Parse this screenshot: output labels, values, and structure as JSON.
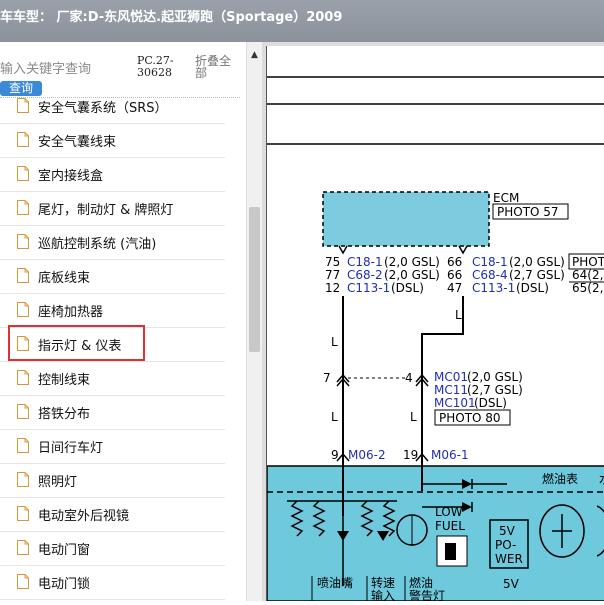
{
  "window": {
    "title": "车车型：  厂家:D-东风悦达.起亚狮跑（Sportage）2009"
  },
  "sidebar": {
    "search_placeholder": "输入关键字查询",
    "query_button": "查询",
    "pc_code_1": "PC.27-",
    "pc_code_2": "30628",
    "collapse_all_1": "折叠全",
    "collapse_all_2": "部",
    "items": [
      {
        "label": "安全气囊系统（SRS）"
      },
      {
        "label": "安全气囊线束"
      },
      {
        "label": "室内接线盒"
      },
      {
        "label": "尾灯，制动灯 & 牌照灯"
      },
      {
        "label": "巡航控制系统 (汽油)"
      },
      {
        "label": "底板线束"
      },
      {
        "label": "座椅加热器"
      },
      {
        "label": "指示灯 & 仪表"
      },
      {
        "label": "控制线束"
      },
      {
        "label": "搭铁分布"
      },
      {
        "label": "日间行车灯"
      },
      {
        "label": "照明灯"
      },
      {
        "label": "电动室外后视镜"
      },
      {
        "label": "电动门窗"
      },
      {
        "label": "电动门锁"
      }
    ],
    "selected_index": 7
  },
  "diagram": {
    "ecm_label": "ECM",
    "photo57": "PHOTO 57",
    "photo_cut": "PHOT",
    "left_pins": [
      "75",
      "77",
      "12"
    ],
    "left_conns": [
      "C18-1",
      "C68-2",
      "C113-1"
    ],
    "left_specs": [
      "(2,0 GSL)",
      "(2,0 GSL)",
      "(DSL)"
    ],
    "right_pins": [
      "66",
      "66",
      "47"
    ],
    "right_conns": [
      "C18-1",
      "C68-4",
      "C113-1"
    ],
    "right_specs": [
      "(2,0 GSL)",
      "(2,7 GSL)",
      "(DSL)"
    ],
    "far_right": [
      "64(2,0",
      "65(2,7"
    ],
    "wire_l": "L",
    "pin7": "7",
    "pin4": "4",
    "mc_conns": [
      "MC01",
      "MC11",
      "MC101"
    ],
    "mc_specs": [
      "(2,0 GSL)",
      "(2,7 GSL)",
      "(DSL)"
    ],
    "photo80": "PHOTO 80",
    "pin9": "9",
    "m06_left": "M06-2",
    "pin19": "19",
    "m06_right": "M06-1",
    "fuel_gauge": "燃油表",
    "water_cut": "水",
    "low_fuel": [
      "LOW",
      "FUEL"
    ],
    "power_5v": [
      "5V",
      "PO-",
      "WER"
    ],
    "label_5v": "5V",
    "injector": "喷油嘴",
    "speed_input": [
      "转速",
      "输入"
    ],
    "fuel_warning": [
      "燃油",
      "警告灯"
    ],
    "colors": {
      "cluster": "#6ec9dc",
      "ecm": "#7ccbde",
      "connector": "#1f2fb0",
      "highlight": "#e03030"
    }
  }
}
